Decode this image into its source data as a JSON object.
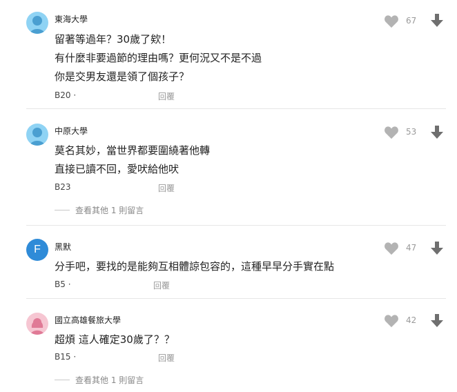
{
  "comments": [
    {
      "author": "東海大學",
      "avatar": "male-silhouette-icon",
      "lines": [
        "留著等過年？30歲了欸！",
        "有什麼非要過節的理由嗎？更何況又不是不過",
        "你是交男友還是領了個孩子？"
      ],
      "floor": "B20",
      "dot": "·",
      "reply_label": "回覆",
      "likes": "67"
    },
    {
      "author": "中原大學",
      "avatar": "male-silhouette-icon",
      "lines": [
        "莫名其妙，當世界都要圍繞著他轉",
        "直接已讀不回，愛吠給他吠"
      ],
      "floor": "B23",
      "dot": "·",
      "reply_label": "回覆",
      "likes": "53",
      "more": "查看其他 1 則留言"
    },
    {
      "author": "黑默",
      "avatar_letter": "F",
      "lines": [
        "分手吧，要找的是能夠互相體諒包容的，這種早早分手實在點"
      ],
      "floor": "B5",
      "dot": "·",
      "reply_label": "回覆",
      "likes": "47"
    },
    {
      "author": "國立高雄餐旅大學",
      "avatar": "female-silhouette-icon",
      "lines": [
        "超煩 這人確定30歲了？？"
      ],
      "floor": "B15",
      "dot": "·",
      "reply_label": "回覆",
      "likes": "42",
      "more": "查看其他 1 則留言"
    }
  ],
  "colors": {
    "male_avatar_bg": "#8fd3f4",
    "male_avatar_fg": "#4a9fd1",
    "female_avatar_bg": "#f6c6d2",
    "female_avatar_fg": "#e07a96",
    "letter_avatar_bg": "#2f8bd8",
    "icon_gray": "#b3b3b3",
    "arrow_gray": "#6f6f6f"
  }
}
